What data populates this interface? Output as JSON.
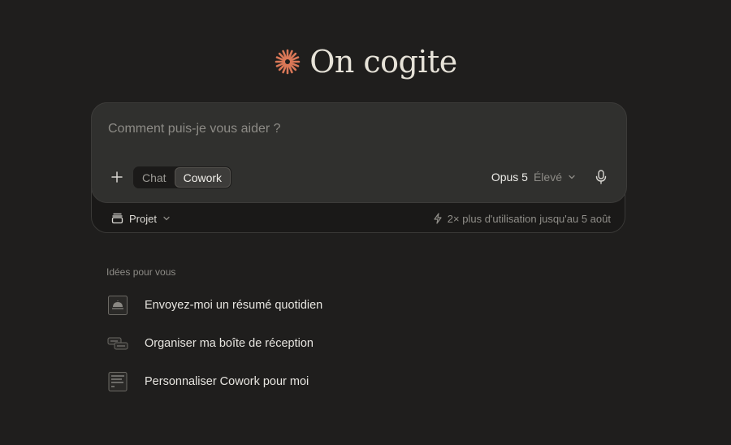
{
  "hero": {
    "icon": "sparkle-asterisk-icon",
    "title": "On cogite",
    "accent_color": "#d97757"
  },
  "composer": {
    "placeholder": "Comment puis-je vous aider ?",
    "value": "",
    "add_icon": "plus-icon",
    "modes": [
      {
        "label": "Chat",
        "active": false
      },
      {
        "label": "Cowork",
        "active": true
      }
    ],
    "model": {
      "name": "Opus 5",
      "level": "Élevé",
      "icon": "chevron-down-icon"
    },
    "mic_icon": "microphone-icon"
  },
  "footer": {
    "project_label": "Projet",
    "project_icon": "project-box-icon",
    "usage_icon": "lightning-icon",
    "usage_text": "2× plus d'utilisation jusqu'au 5 août"
  },
  "ideas": {
    "heading": "Idées pour vous",
    "items": [
      {
        "label": "Envoyez-moi un résumé quotidien",
        "icon": "daily-summary-icon"
      },
      {
        "label": "Organiser ma boîte de réception",
        "icon": "inbox-messages-icon"
      },
      {
        "label": "Personnaliser Cowork pour moi",
        "icon": "customize-document-icon"
      }
    ]
  },
  "colors": {
    "background": "#1f1e1d",
    "composer": "#30302e",
    "accent": "#d97757"
  }
}
